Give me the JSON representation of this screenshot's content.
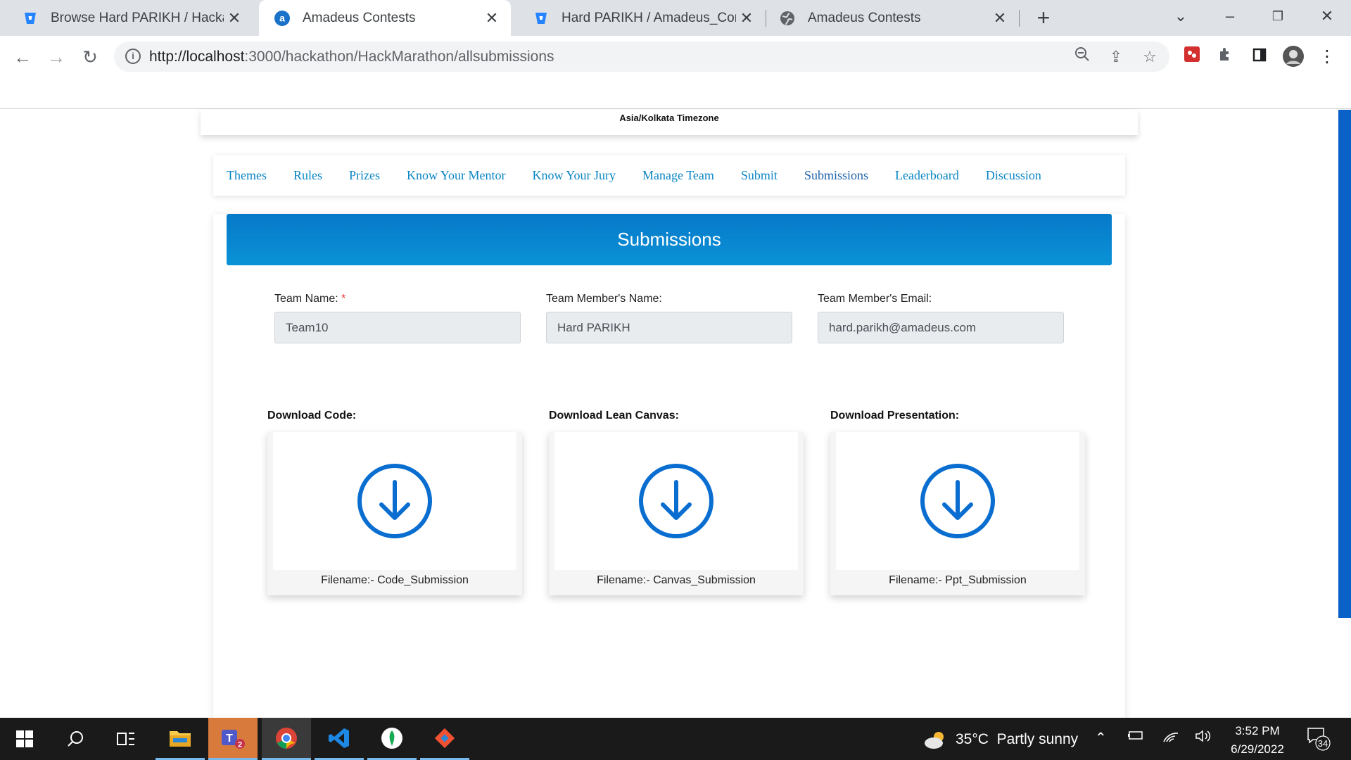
{
  "browser": {
    "tabs": [
      {
        "title": "Browse Hard PARIKH / Hackathon",
        "icon": "bitbucket-icon",
        "active": false
      },
      {
        "title": "Amadeus Contests",
        "icon": "amadeus-icon",
        "active": true
      },
      {
        "title": "Hard PARIKH / Amadeus_Contests",
        "icon": "bitbucket-icon",
        "active": false
      },
      {
        "title": "Amadeus Contests",
        "icon": "globe-icon",
        "active": false
      }
    ],
    "url": {
      "host": "http://localhost",
      "rest": ":3000/hackathon/HackMarathon/allsubmissions"
    }
  },
  "header": {
    "timezone": "Asia/Kolkata Timezone"
  },
  "nav": {
    "items": [
      "Themes",
      "Rules",
      "Prizes",
      "Know Your Mentor",
      "Know Your Jury",
      "Manage Team",
      "Submit",
      "Submissions",
      "Leaderboard",
      "Discussion"
    ],
    "active": "Submissions"
  },
  "submissions": {
    "title": "Submissions",
    "fields": {
      "team_name": {
        "label": "Team Name:",
        "required_mark": "*",
        "value": "Team10"
      },
      "member_name": {
        "label": "Team Member's Name:",
        "value": "Hard PARIKH"
      },
      "member_email": {
        "label": "Team Member's Email:",
        "value": "hard.parikh@amadeus.com"
      }
    },
    "downloads": [
      {
        "label": "Download Code:",
        "filename": "Filename:- Code_Submission"
      },
      {
        "label": "Download Lean Canvas:",
        "filename": "Filename:- Canvas_Submission"
      },
      {
        "label": "Download Presentation:",
        "filename": "Filename:- Ppt_Submission"
      }
    ],
    "accent_color": "#0a6ed1"
  },
  "taskbar": {
    "weather": {
      "temp": "35°C",
      "desc": "Partly sunny"
    },
    "clock": {
      "time": "3:52 PM",
      "date": "6/29/2022"
    },
    "notifications": "34",
    "teams_badge": "2"
  }
}
